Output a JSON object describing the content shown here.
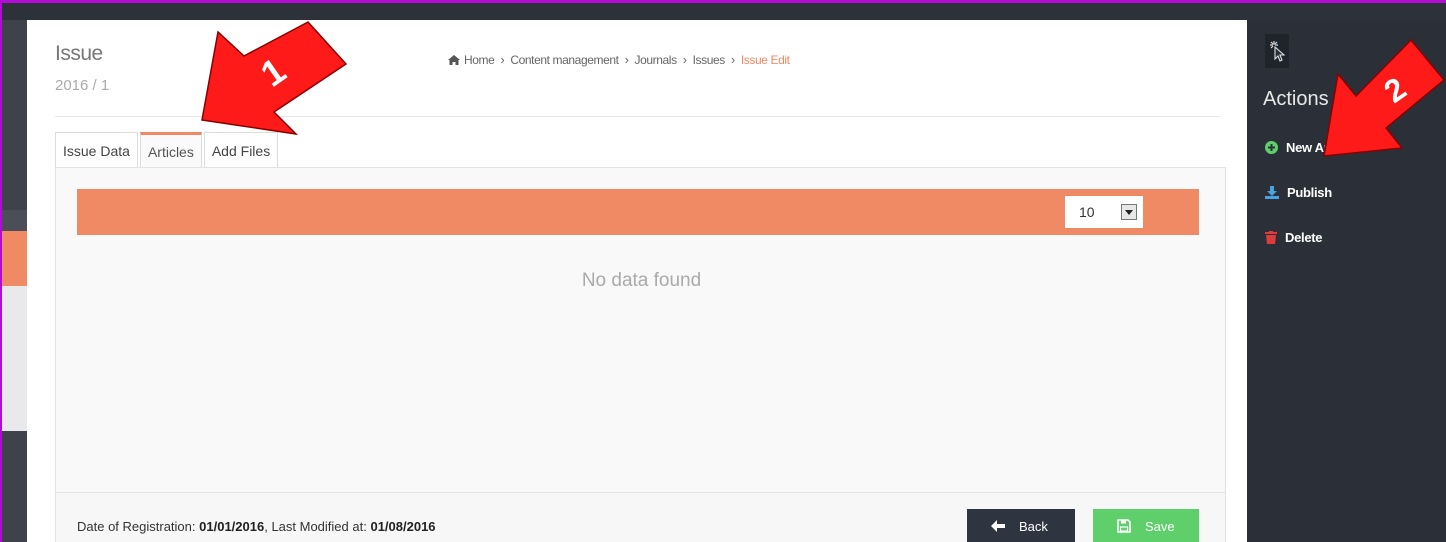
{
  "page": {
    "title": "Issue",
    "subtitle": "2016 / 1"
  },
  "breadcrumb": {
    "home": "Home",
    "items": [
      "Content management",
      "Journals",
      "Issues"
    ],
    "current": "Issue Edit"
  },
  "tabs": [
    {
      "label": "Issue Data",
      "active": false
    },
    {
      "label": "Articles",
      "active": true
    },
    {
      "label": "Add Files",
      "active": false
    }
  ],
  "table": {
    "page_size": "10",
    "empty_message": "No data found"
  },
  "footer": {
    "registration_label": "Date of Registration:",
    "registration_date": "01/01/2016",
    "modified_label": ", Last Modified at:",
    "modified_date": "01/08/2016",
    "back_label": "Back",
    "save_label": "Save"
  },
  "sidebar": {
    "title": "Actions",
    "actions": [
      {
        "label": "New Article",
        "icon": "plus-circle-icon",
        "color": "#5fcf6b"
      },
      {
        "label": "Publish",
        "icon": "download-icon",
        "color": "#4aa3df"
      },
      {
        "label": "Delete",
        "icon": "trash-icon",
        "color": "#e03b3b"
      }
    ]
  },
  "annotations": {
    "marker_1": "1",
    "marker_2": "2"
  },
  "colors": {
    "accent": "#ef8a64",
    "save": "#5fcf6b",
    "back": "#2e3440",
    "sidebar": "#2b3038",
    "annotation": "#ff0000"
  }
}
